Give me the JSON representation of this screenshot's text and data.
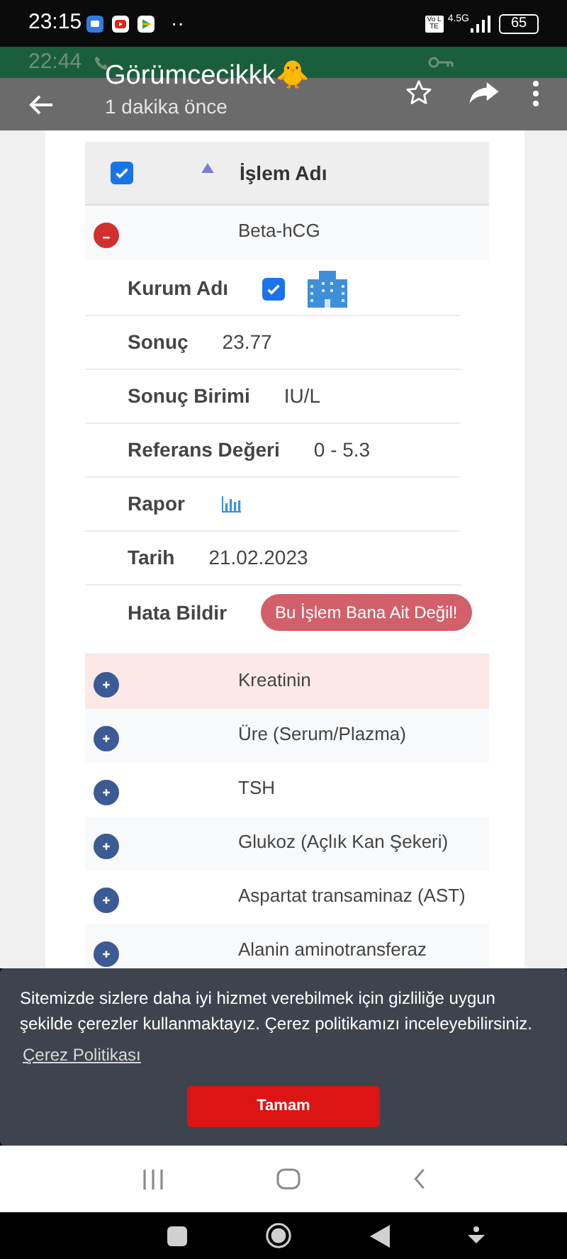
{
  "status_bar": {
    "time": "23:15",
    "more": "··",
    "volte": "Vo LTE",
    "network": "4.5G",
    "battery": "65"
  },
  "inner_status_bar": {
    "time": "22:44"
  },
  "header": {
    "title": "Görümcecikkk🐥",
    "subtitle": "1 dakika önce"
  },
  "table": {
    "header": {
      "checked": true,
      "label": "İşlem Adı"
    },
    "rows": [
      {
        "name": "Beta-hCG",
        "expanded": true,
        "highlighted": false,
        "details": [
          {
            "kind": "checkbox",
            "label": "Kurum Adı",
            "checked": true
          },
          {
            "kind": "text",
            "label": "Sonuç",
            "value": "23.77"
          },
          {
            "kind": "text",
            "label": "Sonuç Birimi",
            "value": "IU/L"
          },
          {
            "kind": "text",
            "label": "Referans Değeri",
            "value": "0 - 5.3"
          },
          {
            "kind": "report",
            "label": "Rapor"
          },
          {
            "kind": "text",
            "label": "Tarih",
            "value": "21.02.2023"
          },
          {
            "kind": "button",
            "label": "Hata Bildir",
            "value": "Bu İşlem Bana Ait Değil!"
          }
        ]
      },
      {
        "name": "Kreatinin",
        "expanded": false,
        "highlighted": true
      },
      {
        "name": "Üre (Serum/Plazma)",
        "expanded": false,
        "highlighted": false
      },
      {
        "name": "TSH",
        "expanded": false,
        "highlighted": false
      },
      {
        "name": "Glukoz (Açlık Kan Şekeri)",
        "expanded": false,
        "highlighted": false
      },
      {
        "name": "Aspartat transaminaz (AST)",
        "expanded": false,
        "highlighted": false
      },
      {
        "name": "Alanin aminotransferaz",
        "expanded": false,
        "highlighted": false
      }
    ]
  },
  "cookie_banner": {
    "text": "Sitemizde sizlere daha iyi hizmet verebilmek için gizliliğe uygun şekilde çerezler kullanmaktayız. Çerez politikamızı inceleyebilirsiniz.",
    "link": "Çerez Politikası",
    "button": "Tamam"
  }
}
